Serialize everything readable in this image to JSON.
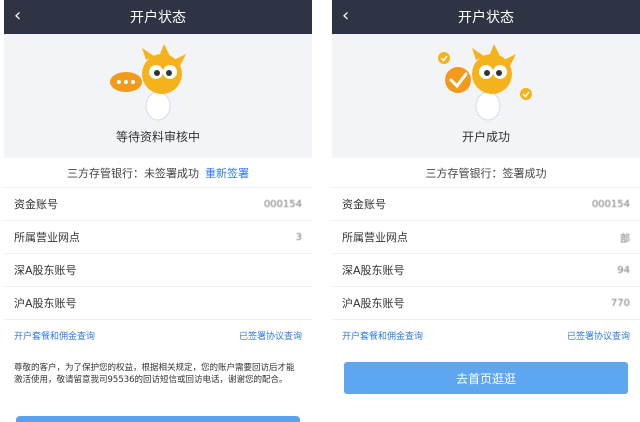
{
  "left": {
    "title": "开户状态",
    "back_icon": "chevron-left-icon",
    "status": "等待资料审核中",
    "bank": {
      "label": "三方存管银行：未签署成功",
      "link": "重新签署"
    },
    "rows": [
      {
        "label": "资金账号",
        "value": "000154"
      },
      {
        "label": "所属营业网点",
        "value": "3"
      },
      {
        "label": "深A股东账号",
        "value": ""
      },
      {
        "label": "沪A股东账号",
        "value": ""
      }
    ],
    "links": {
      "left": "开户套餐和佣金查询",
      "right": "已签署协议查询"
    },
    "notice": "尊敬的客户，为了保护您的权益，根据相关规定，您的账户需要回访后才能激活使用，敬请留意我司95536的回访短信或回访电话，谢谢您的配合。"
  },
  "right": {
    "title": "开户状态",
    "back_icon": "chevron-left-icon",
    "status": "开户成功",
    "bank": {
      "label": "三方存管银行：签署成功"
    },
    "rows": [
      {
        "label": "资金账号",
        "value": "000154"
      },
      {
        "label": "所属营业网点",
        "value": "部"
      },
      {
        "label": "深A股东账号",
        "value": "94"
      },
      {
        "label": "沪A股东账号",
        "value": "770"
      }
    ],
    "links": {
      "left": "开户套餐和佣金查询",
      "right": "已签署协议查询"
    },
    "cta": "去首页逛逛"
  },
  "colors": {
    "topbar": "#2f3445",
    "link": "#2f7ae5",
    "cta": "#5ea6f0",
    "hero_bg": "#f2f4f8",
    "mascot": "#f6b21a"
  }
}
